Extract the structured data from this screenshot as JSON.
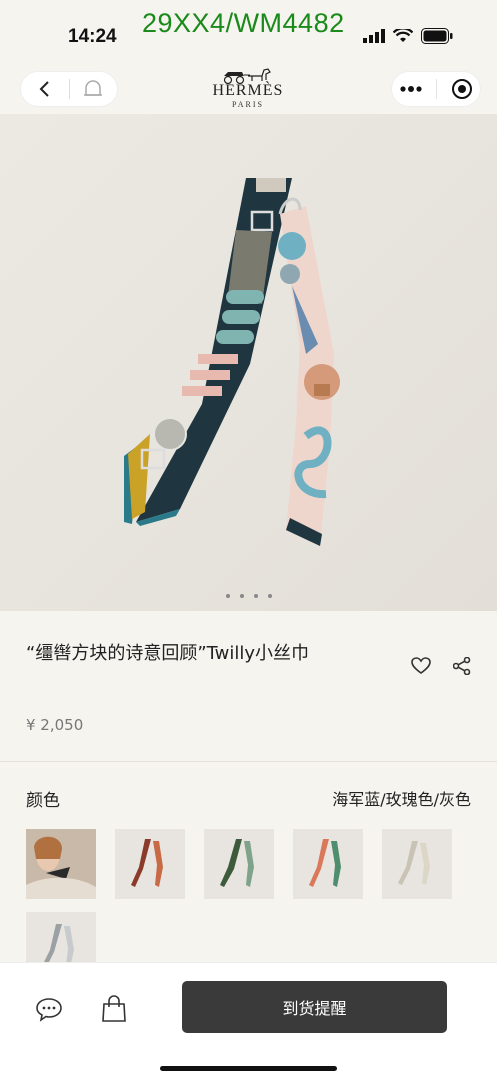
{
  "status": {
    "time": "14:24",
    "watermark": "29XX4/WM4482"
  },
  "nav": {
    "brand_name": "HERMÈS",
    "brand_city": "PARIS"
  },
  "gallery": {
    "dots_count": 4,
    "active_index": 0
  },
  "product": {
    "title": "“缰辔方块的诗意回顾”Twilly小丝巾",
    "price": "¥ 2,050"
  },
  "color": {
    "label": "颜色",
    "selected": "海军蓝/玫瑰色/灰色"
  },
  "actions": {
    "notify_label": "到货提醒"
  },
  "icons": [
    "back-icon",
    "bell-icon",
    "more-icon",
    "target-icon",
    "heart-icon",
    "share-icon",
    "chat-icon",
    "bag-icon"
  ]
}
